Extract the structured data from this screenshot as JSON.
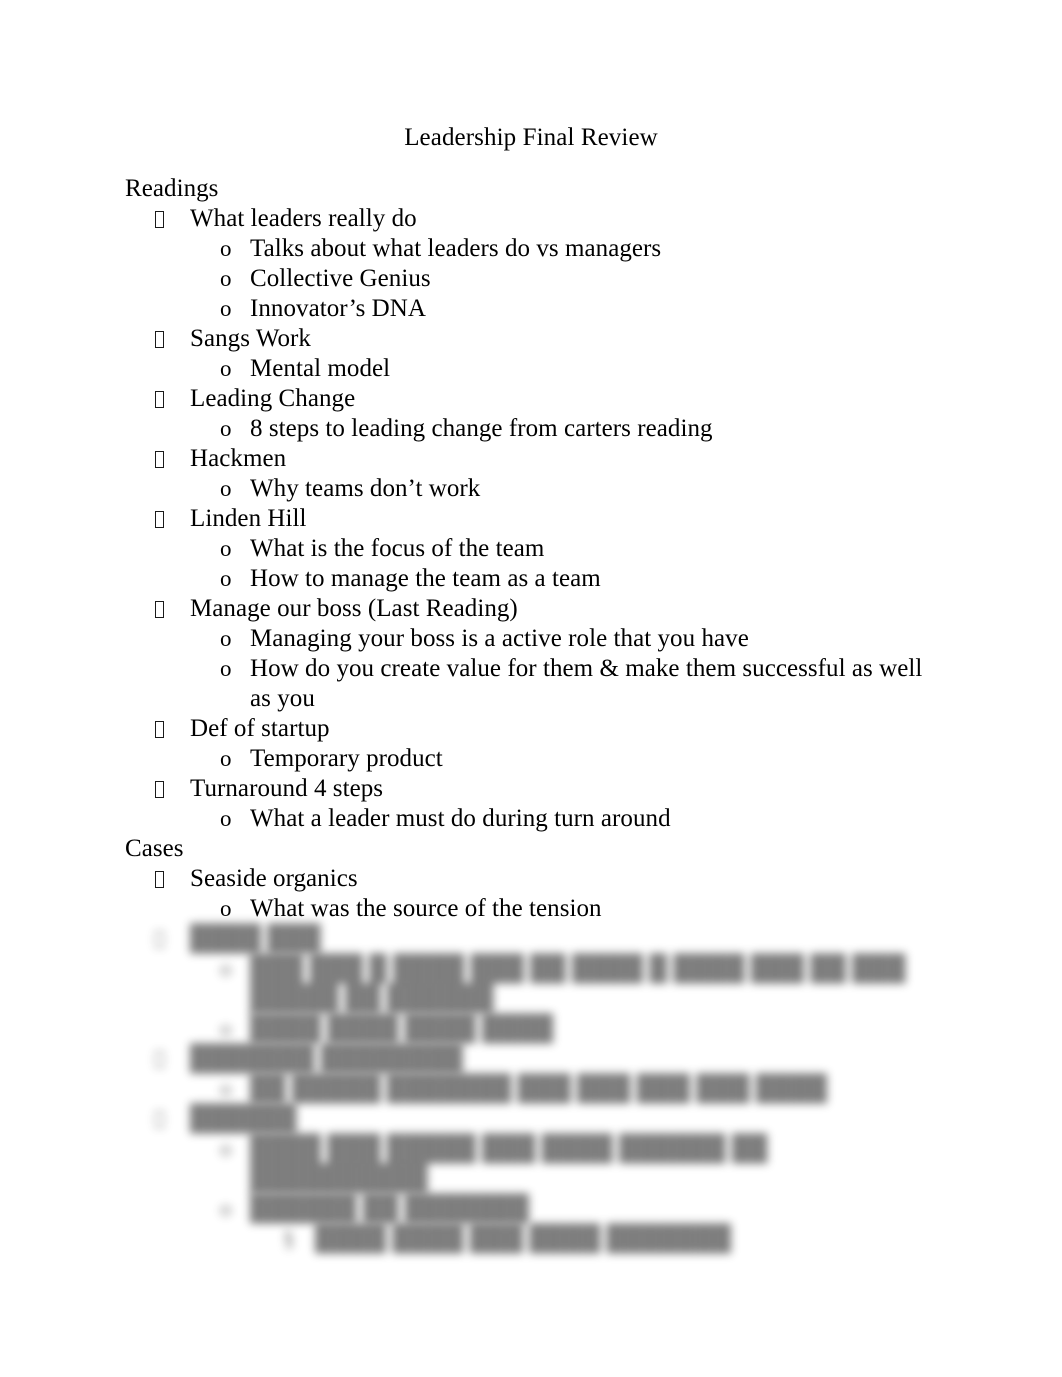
{
  "document": {
    "title": "Leadership Final Review",
    "bullet_glyph": "missing-glyph-box",
    "level2_marker": "o",
    "level3_marker": "§",
    "background_color": "#ffffff",
    "text_color": "#000000"
  },
  "sections": [
    {
      "heading": "Readings",
      "items": [
        {
          "label": "What leaders really do",
          "children": [
            {
              "label": "Talks about what leaders do vs managers"
            },
            {
              "label": "Collective Genius"
            },
            {
              "label": "Innovator’s DNA"
            }
          ]
        },
        {
          "label": "Sangs Work",
          "children": [
            {
              "label": "Mental model"
            }
          ]
        },
        {
          "label": "Leading Change",
          "children": [
            {
              "label": "8 steps to leading change from carters reading"
            }
          ]
        },
        {
          "label": "Hackmen",
          "children": [
            {
              "label": "Why teams don’t work"
            }
          ]
        },
        {
          "label": "Linden Hill",
          "children": [
            {
              "label": "What is the focus of the team"
            },
            {
              "label": "How to manage the team as a team"
            }
          ]
        },
        {
          "label": "Manage our boss (Last Reading)",
          "children": [
            {
              "label": "Managing your boss is a active role that you have"
            },
            {
              "label": "How do you create value for them & make them successful as well as you"
            }
          ]
        },
        {
          "label": "Def of startup",
          "children": [
            {
              "label": "Temporary product"
            }
          ]
        },
        {
          "label": "Turnaround 4 steps",
          "children": [
            {
              "label": "What a leader must do during turn around"
            }
          ]
        }
      ]
    },
    {
      "heading": "Cases",
      "items": [
        {
          "label": "Seaside organics",
          "children": [
            {
              "label": "What was the source of the tension"
            }
          ]
        }
      ]
    }
  ],
  "redacted_region": {
    "note": "blurred-illegible",
    "lines": [
      {
        "level": 1,
        "text": "████ ███"
      },
      {
        "level": 2,
        "text": "███ ███ █ ████ ███ ██ ████ █ ████ ███ ██ ███ █████ ██ ██████"
      },
      {
        "level": 2,
        "text": "████ ████ ████ ████"
      },
      {
        "level": 1,
        "text": "███████ ████████"
      },
      {
        "level": 2,
        "text": "██ █████ ███████ ███ ███ ███ ███ ████"
      },
      {
        "level": 1,
        "text": "██████"
      },
      {
        "level": 2,
        "text": "████ ███ █████ ███ ████ ██████ ██ ██████████"
      },
      {
        "level": 2,
        "text": "██████ ██ ███████"
      },
      {
        "level": 3,
        "text": "████ ████ ███ ████ ███████"
      }
    ]
  }
}
